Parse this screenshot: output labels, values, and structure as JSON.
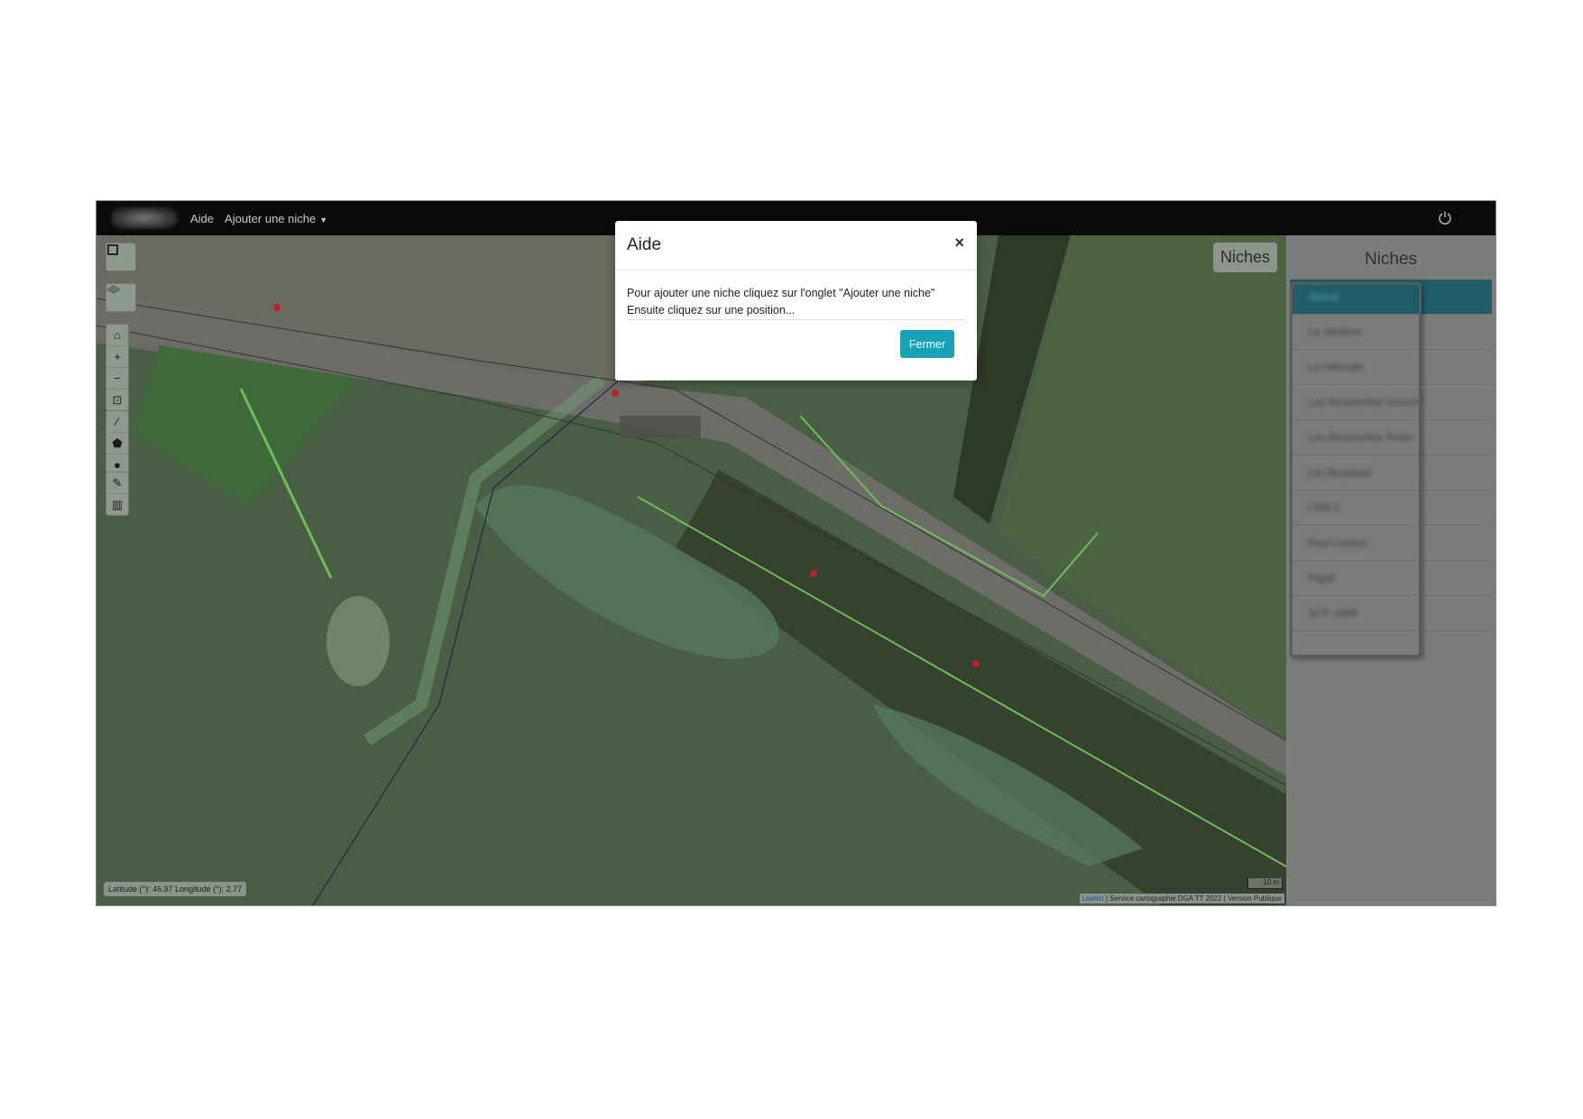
{
  "navbar": {
    "links": [
      "Aide",
      "Ajouter une niche"
    ]
  },
  "map": {
    "coords": "Latitude (°): 46.97 Longitude (°): 2.77",
    "scale": "10 m",
    "attribution_link": "Leaflet",
    "attribution_rest": " | Service cartographie DGA TT 2022 | Version Publique",
    "chip": "Niches"
  },
  "panel": {
    "title": "Niches",
    "items": [
      "Abrest",
      "La Jardière",
      "La Hétrodie",
      "Les Bourberlles Grande",
      "Les Bourberlles Petite",
      "Les Bruyères",
      "LRM 3",
      "Paul Lecken",
      "Pigall",
      "SCP 1999"
    ]
  },
  "modal": {
    "title": "Aide",
    "close": "×",
    "line1": "Pour ajouter une niche cliquez sur l'onglet \"Ajouter une niche\"",
    "line2": "Ensuite cliquez sur une position...",
    "button": "Fermer"
  },
  "colors": {
    "accent": "#17a2b8",
    "navbar": "#0b0b0b"
  }
}
